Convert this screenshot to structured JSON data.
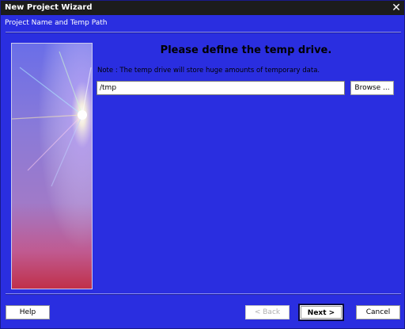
{
  "window": {
    "title": "New Project Wizard",
    "close_glyph": "✕"
  },
  "step": {
    "subtitle": "Project Name and Temp Path",
    "heading": "Please define the temp drive.",
    "note": "Note : The temp drive will store huge amounts of temporary data."
  },
  "temp_path": {
    "value": "/tmp"
  },
  "buttons": {
    "browse": "Browse ...",
    "help": "Help",
    "back": "< Back",
    "next": "Next >",
    "cancel": "Cancel"
  },
  "colors": {
    "background": "#2a2ee0",
    "titlebar": "#1c1c1c"
  }
}
